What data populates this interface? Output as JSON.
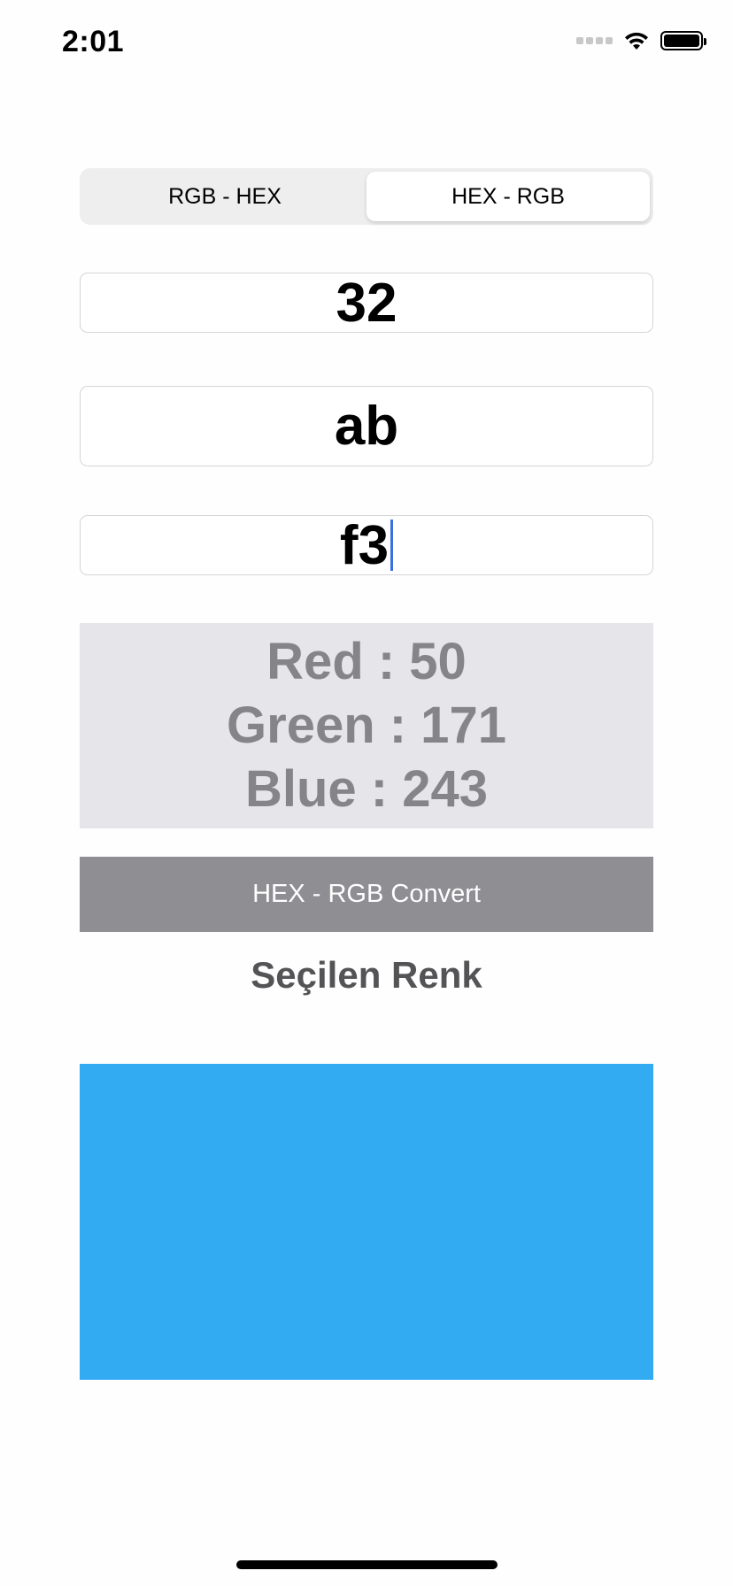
{
  "status_bar": {
    "time": "2:01"
  },
  "segmented_control": {
    "options": [
      "RGB - HEX",
      "HEX - RGB"
    ],
    "selected": "HEX - RGB"
  },
  "inputs": {
    "red_hex": "32",
    "green_hex": "ab",
    "blue_hex": "f3"
  },
  "result": {
    "red": "Red : 50",
    "green": "Green : 171",
    "blue": "Blue : 243"
  },
  "convert_button": {
    "label": "HEX - RGB Convert"
  },
  "selected_color": {
    "label": "Seçilen Renk",
    "hex": "#32abf3"
  },
  "colors": {
    "result_background": "#e5e5ea",
    "button_background": "#8e8e93",
    "caret": "#3b6fe0"
  }
}
